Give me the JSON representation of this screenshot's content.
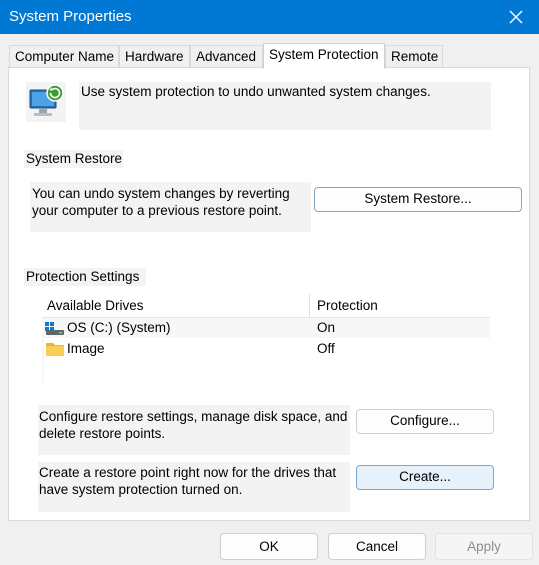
{
  "window": {
    "title": "System Properties"
  },
  "tabs": [
    {
      "label": "Computer Name"
    },
    {
      "label": "Hardware"
    },
    {
      "label": "Advanced"
    },
    {
      "label": "System Protection"
    },
    {
      "label": "Remote"
    }
  ],
  "intro": {
    "text": "Use system protection to undo unwanted system changes."
  },
  "system_restore": {
    "heading": "System Restore",
    "line1": "You can undo system changes by reverting",
    "line2": "your computer to a previous restore point.",
    "button": "System Restore..."
  },
  "protection": {
    "heading": "Protection Settings",
    "columns": {
      "drives": "Available Drives",
      "protection": "Protection"
    },
    "drives": [
      {
        "name": "OS (C:) (System)",
        "protection": "On",
        "icon": "system-drive-icon"
      },
      {
        "name": "Image",
        "protection": "Off",
        "icon": "folder-icon"
      }
    ]
  },
  "configure": {
    "line1": "Configure restore settings, manage disk space, and",
    "line2": "delete restore points.",
    "button": "Configure..."
  },
  "create": {
    "line1": "Create a restore point right now for the drives that",
    "line2": "have system protection turned on.",
    "button": "Create..."
  },
  "footer": {
    "ok": "OK",
    "cancel": "Cancel",
    "apply": "Apply"
  },
  "colors": {
    "titlebar": "#0078d4",
    "accent_hover": "#e5f1fb"
  }
}
